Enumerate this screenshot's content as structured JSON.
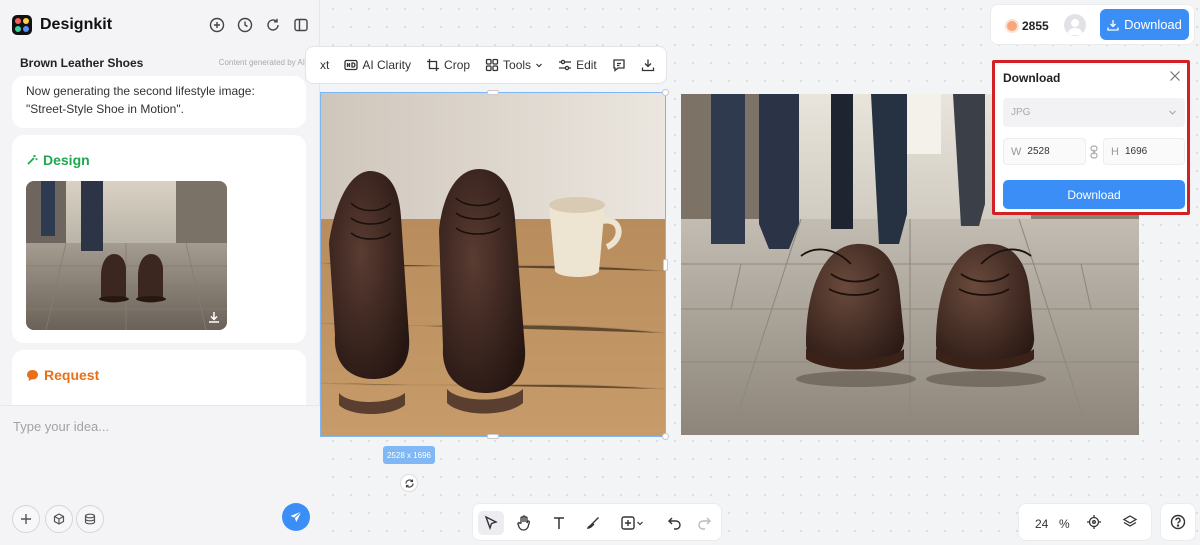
{
  "app": {
    "name": "Designkit"
  },
  "project": {
    "title": "Brown Leather Shoes",
    "ai_note": "Content generated by AI"
  },
  "chat": {
    "message": "Now generating the second lifestyle image: \"Street-Style Shoe in Motion\".",
    "design_title": "Design",
    "request_title": "Request",
    "input_placeholder": "Type your idea..."
  },
  "toolbar": {
    "partial_label": "xt",
    "ai_clarity": "AI Clarity",
    "crop": "Crop",
    "tools": "Tools",
    "edit": "Edit"
  },
  "canvas": {
    "selected_size": "2528 x 1696"
  },
  "header": {
    "credits": "2855",
    "download_label": "Download"
  },
  "download_popup": {
    "title": "Download",
    "format": "JPG",
    "width_label": "W",
    "width": "2528",
    "height_label": "H",
    "height": "1696",
    "button": "Download"
  },
  "zoom": {
    "value": "24",
    "unit": "%"
  },
  "colors": {
    "accent": "#3a8ef6",
    "highlight": "#d32027",
    "design": "#1fa84f",
    "request": "#e8701a"
  }
}
